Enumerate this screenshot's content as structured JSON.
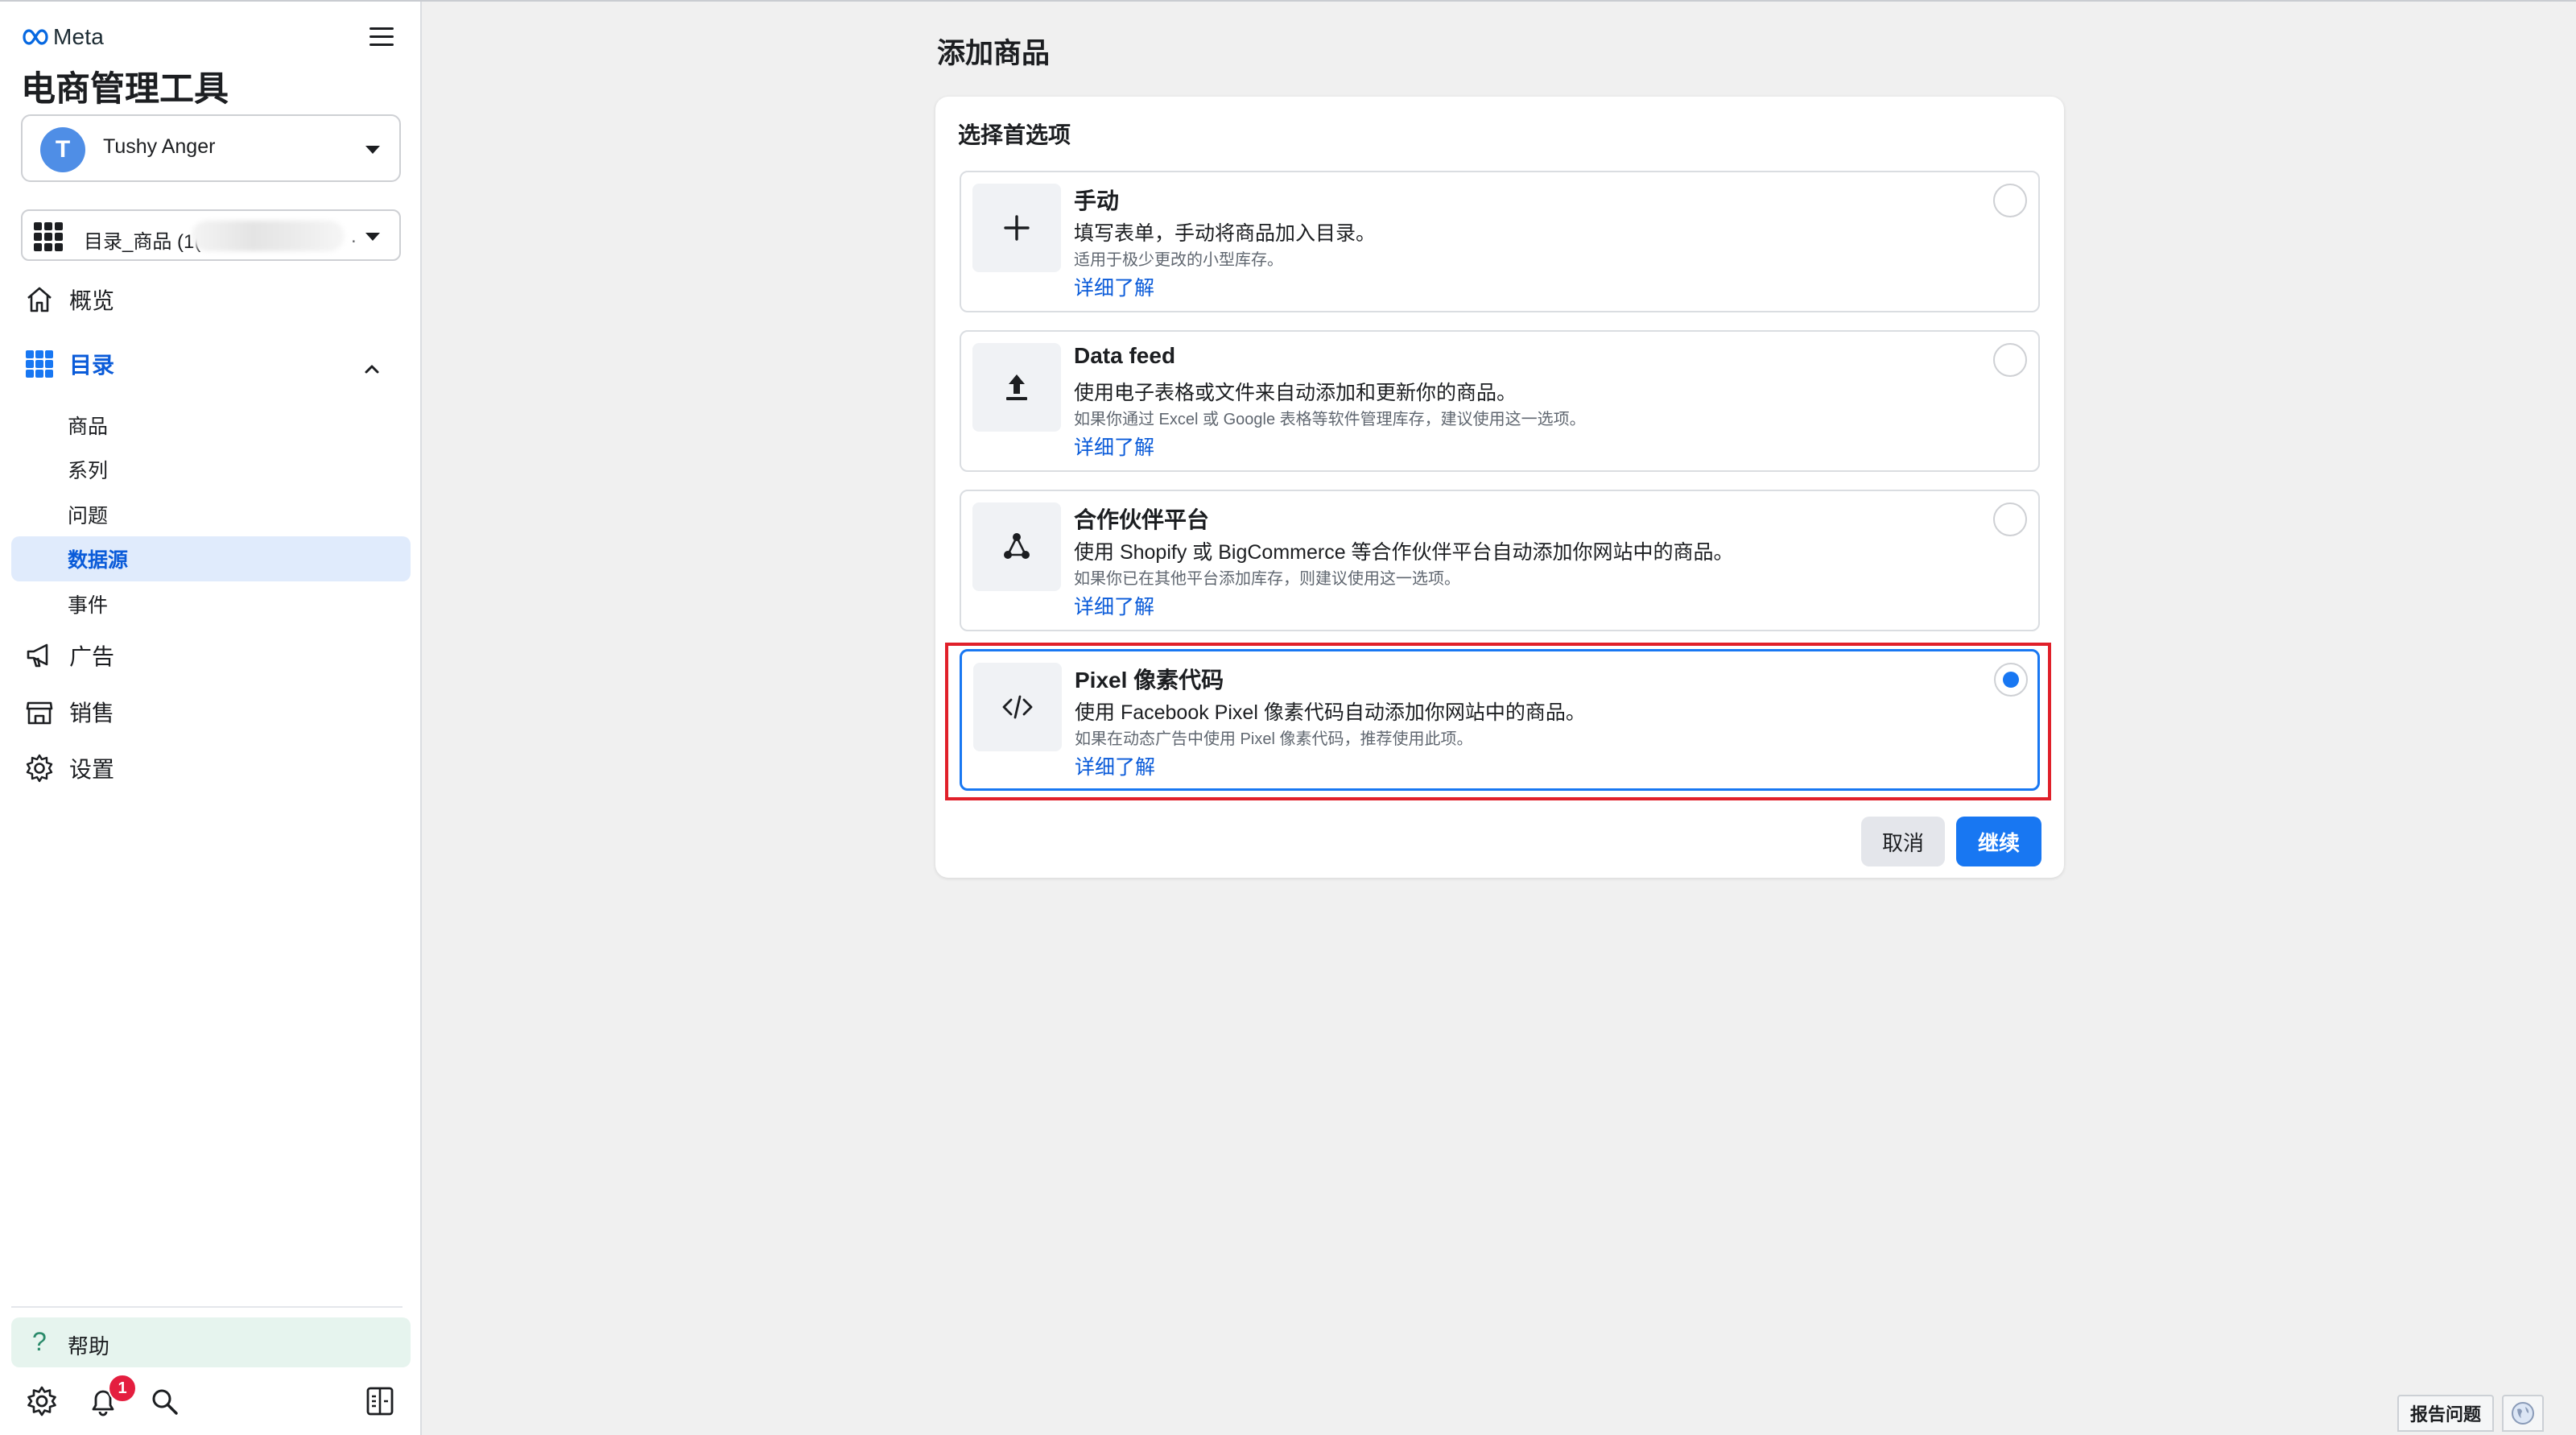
{
  "brand": {
    "logo_text": "Meta",
    "app_title": "电商管理工具"
  },
  "account": {
    "initial": "T",
    "name": "Tushy Anger"
  },
  "catalog": {
    "label": "目录_商品 (1(",
    "suffix": "."
  },
  "nav": {
    "overview": "概览",
    "catalog": "目录",
    "catalog_sub": [
      "商品",
      "系列",
      "问题",
      "数据源",
      "事件"
    ],
    "ads": "广告",
    "sales": "销售",
    "settings": "设置"
  },
  "help": {
    "icon": "?",
    "label": "帮助"
  },
  "notifications": {
    "count": "1"
  },
  "page": {
    "title": "添加商品",
    "card_heading": "选择首选项"
  },
  "options": [
    {
      "title": "手动",
      "desc": "填写表单，手动将商品加入目录。",
      "note": "适用于极少更改的小型库存。",
      "link": "详细了解",
      "icon": "plus-icon",
      "selected": false
    },
    {
      "title": "Data feed",
      "desc": "使用电子表格或文件来自动添加和更新你的商品。",
      "note": "如果你通过 Excel 或 Google 表格等软件管理库存，建议使用这一选项。",
      "link": "详细了解",
      "icon": "upload-icon",
      "selected": false
    },
    {
      "title": "合作伙伴平台",
      "desc": "使用 Shopify 或 BigCommerce 等合作伙伴平台自动添加你网站中的商品。",
      "note": "如果你已在其他平台添加库存，则建议使用这一选项。",
      "link": "详细了解",
      "icon": "network-icon",
      "selected": false
    },
    {
      "title": "Pixel 像素代码",
      "desc": "使用 Facebook Pixel 像素代码自动添加你网站中的商品。",
      "note": "如果在动态广告中使用 Pixel 像素代码，推荐使用此项。",
      "link": "详细了解",
      "icon": "code-icon",
      "selected": true
    }
  ],
  "actions": {
    "cancel": "取消",
    "continue": "继续"
  },
  "footer": {
    "report": "报告问题"
  },
  "colors": {
    "accent": "#1877f2",
    "active_nav": "#0a5bd9",
    "highlight": "#e0202a"
  }
}
